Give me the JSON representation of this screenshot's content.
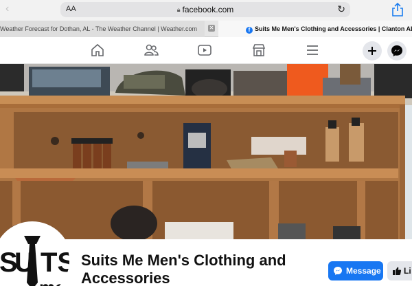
{
  "browser": {
    "text_size_label": "AA",
    "url": "facebook.com",
    "tabs": [
      {
        "title": "Weather Forecast for Dothan, AL - The Weather Channel | Weather.com"
      },
      {
        "title": "Suits Me Men's Clothing and Accessories | Clanton AL | Faceb"
      }
    ]
  },
  "fb_nav": {
    "icons": [
      "home-icon",
      "friends-icon",
      "watch-icon",
      "marketplace-icon",
      "menu-icon"
    ],
    "right_buttons": [
      "plus-icon",
      "messenger-icon"
    ]
  },
  "page": {
    "name": "Suits Me Men's Clothing and Accessories",
    "logo_text_top": "SUITS",
    "logo_text_bottom": "me",
    "message_label": "Message",
    "like_label": "Li"
  },
  "colors": {
    "brand": "#1877f2",
    "button_grey": "#e4e6eb"
  }
}
